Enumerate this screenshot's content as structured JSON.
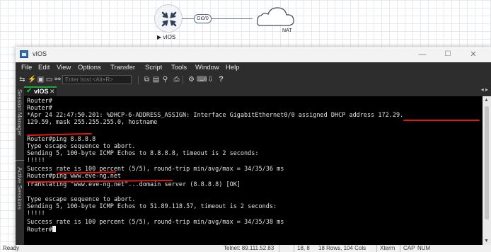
{
  "topology": {
    "router_label": "vIOS",
    "interface_label": "Gi0/0",
    "nat_label": "NAT"
  },
  "window": {
    "title": "vIOS",
    "controls": {
      "minimize": "—",
      "maximize": "☐",
      "close": "✕"
    }
  },
  "menu": [
    "File",
    "Edit",
    "View",
    "Options",
    "Transfer",
    "Script",
    "Tools",
    "Window",
    "Help"
  ],
  "toolbar": {
    "host_placeholder": "Enter host <Alt+R>",
    "help": "?"
  },
  "side_panel": {
    "session_manager": "Session Manager",
    "active_sessions": "Active Sessions"
  },
  "tab": {
    "label": "vIOS",
    "close": "✕",
    "nav": "◂ ▸"
  },
  "terminal": {
    "lines": [
      "Router#",
      "Router#",
      "*Apr 24 22:47:50.201: %DHCP-6-ADDRESS_ASSIGN: Interface GigabitEthernet0/0 assigned DHCP address 172.29.",
      "129.59, mask 255.255.255.0, hostname",
      "",
      "Router#ping 8.8.8.8",
      "Type escape sequence to abort.",
      "Sending 5, 100-byte ICMP Echos to 8.8.8.8, timeout is 2 seconds:",
      "!!!!!",
      "Success rate is 100 percent (5/5), round-trip min/avg/max = 34/35/36 ms",
      "Router#ping www.eve-ng.net",
      "Translating \"www.eve-ng.net\"...domain server (8.8.8.8) [OK]",
      "",
      "Type escape sequence to abort.",
      "Sending 5, 100-byte ICMP Echos to 51.89.118.57, timeout is 2 seconds:",
      "!!!!!",
      "Success rate is 100 percent (5/5), round-trip min/avg/max = 34/35/38 ms",
      "Router#"
    ]
  },
  "statusbar": {
    "ready": "Ready",
    "telnet": "Telnet: 89.111.52.83",
    "position": "18,  8",
    "size": "18 Rows, 104 Cols",
    "term_type": "Xterm",
    "caps": "CAP",
    "num": "NUM"
  },
  "colors": {
    "annotation": "#e01818",
    "tab_accent": "#1ea53a",
    "terminal_bg": "#000000",
    "terminal_fg": "#e2e2e2"
  }
}
